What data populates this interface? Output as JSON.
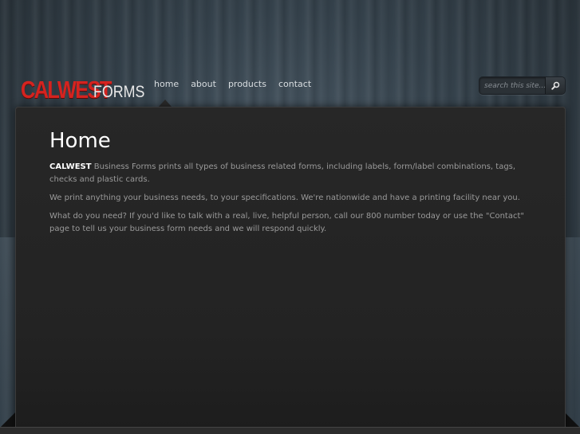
{
  "logo": {
    "main": "CALWEST",
    "sub": "FORMS"
  },
  "nav": {
    "items": [
      {
        "label": "home"
      },
      {
        "label": "about"
      },
      {
        "label": "products"
      },
      {
        "label": "contact"
      }
    ]
  },
  "search": {
    "placeholder": "search this site...",
    "icon": "magnifier-icon"
  },
  "page": {
    "title": "Home",
    "paragraphs": [
      {
        "brand": "CALWEST",
        "text": " Business Forms prints all types of business related forms, including labels, form/label combinations, tags, checks and plastic cards."
      },
      {
        "text": "We print anything your business needs, to your specifications. We're nationwide and have a printing facility near you."
      },
      {
        "text": "What do you need? If you'd like to talk with a real, live, helpful person, call our 800 number today or use the \"Contact\" page to tell us your business form needs and we will respond quickly."
      }
    ]
  },
  "colors": {
    "logo_red": "#d5231f",
    "panel_bg": "#252525",
    "body_text": "#9a9a9a"
  }
}
